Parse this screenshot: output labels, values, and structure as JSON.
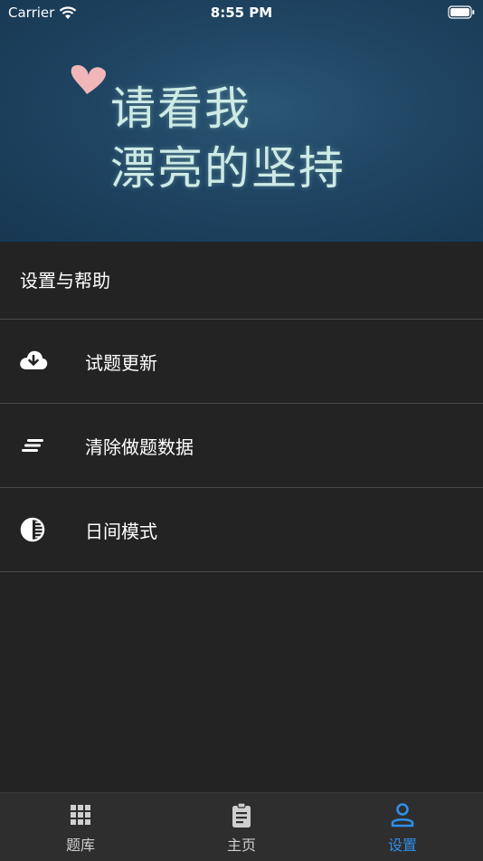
{
  "status_bar": {
    "carrier": "Carrier",
    "time": "8:55 PM"
  },
  "banner": {
    "line1": "请看我",
    "line2": "漂亮的坚持"
  },
  "section": {
    "title": "设置与帮助"
  },
  "menu": [
    {
      "label": "试题更新",
      "icon": "cloud-download-icon"
    },
    {
      "label": "清除做题数据",
      "icon": "clear-lines-icon"
    },
    {
      "label": "日间模式",
      "icon": "contrast-icon"
    }
  ],
  "tabs": [
    {
      "label": "题库",
      "icon": "grid-icon"
    },
    {
      "label": "主页",
      "icon": "clipboard-icon"
    },
    {
      "label": "设置",
      "icon": "user-icon"
    }
  ],
  "colors": {
    "accent": "#2f8fea",
    "background": "#232323",
    "tab_bar": "#2e2e2e"
  }
}
